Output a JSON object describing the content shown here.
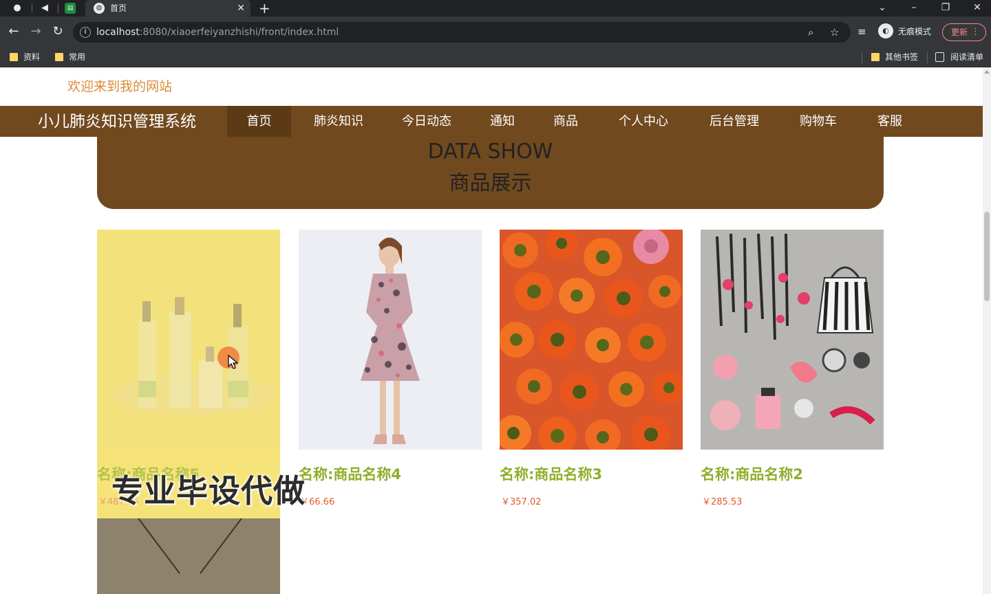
{
  "browser": {
    "tab_title": "首页",
    "url_host": "localhost",
    "url_path": ":8080/xiaoerfeiyanzhishi/front/index.html",
    "incognito_label": "无痕模式",
    "update_label": "更新",
    "bookmarks": [
      "资料",
      "常用"
    ],
    "other_bookmarks": "其他书签",
    "reading_list": "阅读清单"
  },
  "site": {
    "welcome": "欢迎来到我的网站",
    "brand": "小儿肺炎知识管理系统",
    "nav": [
      "首页",
      "肺炎知识",
      "今日动态",
      "通知",
      "商品",
      "个人中心",
      "后台管理",
      "购物车",
      "客服"
    ],
    "active_nav": "首页"
  },
  "banner": {
    "title_en": "DATA SHOW",
    "title_cn": "商品展示"
  },
  "products": [
    {
      "name": "名称:商品名称5",
      "price": "￥487.76"
    },
    {
      "name": "名称:商品名称4",
      "price": "￥66.66"
    },
    {
      "name": "名称:商品名称3",
      "price": "￥357.02"
    },
    {
      "name": "名称:商品名称2",
      "price": "￥285.53"
    }
  ],
  "watermark": "专业毕设代做",
  "colors": {
    "nav_bg": "#71491f",
    "welcome_text": "#d98b3a",
    "product_name": "#8fae2b",
    "price": "#e05a2b",
    "hover_card": "#f5e37a"
  }
}
